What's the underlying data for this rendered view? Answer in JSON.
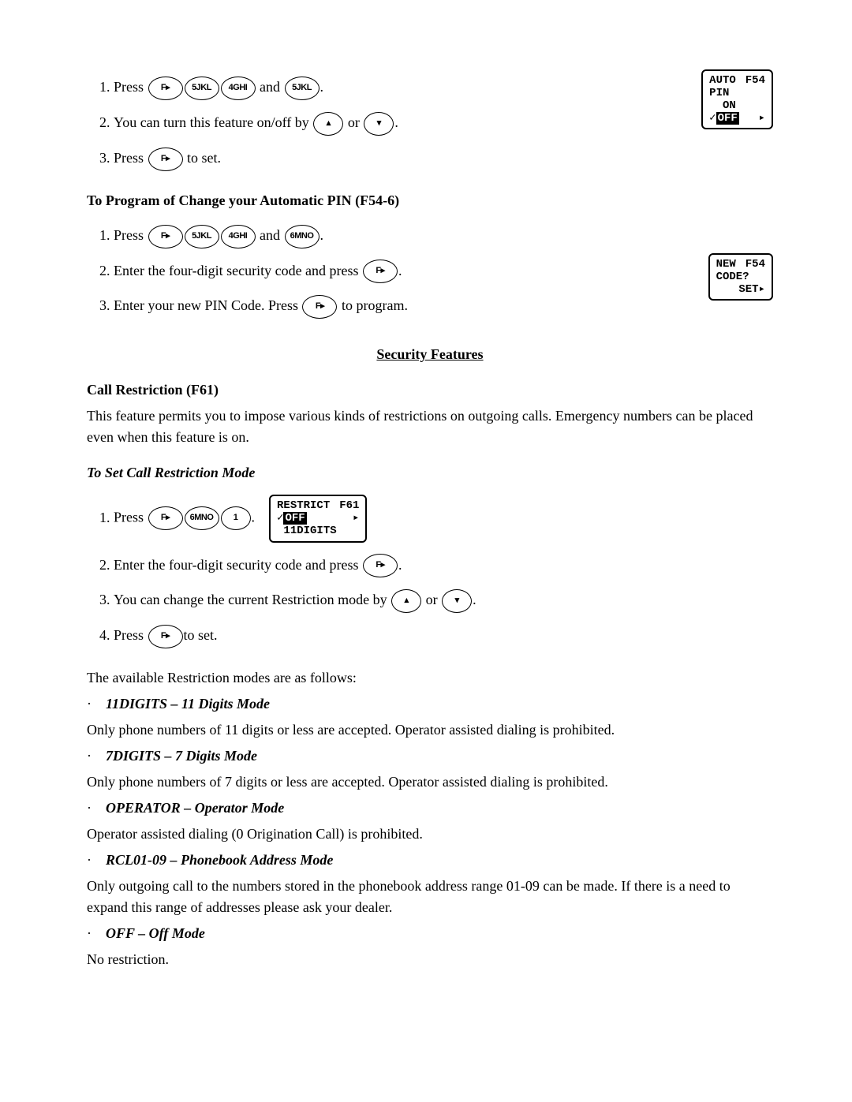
{
  "step1": {
    "press": "Press",
    "and": " and ",
    "btnF": "F▸",
    "btn5": "5JKL",
    "btn4": "4GHI",
    "btn5b": "5JKL",
    "period": ".",
    "screen": {
      "l1a": "AUTO",
      "l1b": "F54",
      "l2": "PIN",
      "l3": "  ON",
      "l4a": "✓",
      "l4sel": "OFF",
      "l4b": "▸"
    }
  },
  "step2": {
    "text1": "You can turn this feature on/off by ",
    "btnUp": "▴",
    "or": " or ",
    "btnDn": "▾",
    "period": "."
  },
  "step3": {
    "press": "Press ",
    "btnF": "F▸",
    "text2": " to set."
  },
  "h_prog": "To Program of Change your Automatic PIN (F54-6)",
  "pstep1": {
    "press": "Press",
    "btnF": "F▸",
    "btn5": "5JKL",
    "btn4": "4GHI",
    "and": " and ",
    "btn6": "6MNO",
    "period": "."
  },
  "pstep2": {
    "text": "Enter the four-digit security code and press ",
    "btnF": "F▸",
    "period": ".",
    "screen": {
      "l1a": "NEW",
      "l1b": "F54",
      "l2": "CODE?",
      "l3b": "SET▸"
    }
  },
  "pstep3": {
    "text1": "Enter your new PIN Code.  Press ",
    "btnF": "F▸",
    "text2": " to program."
  },
  "h_sec": "Security Features",
  "h_call": "Call Restriction (F61)",
  "p_call": "This feature permits you to impose various kinds of restrictions on outgoing calls.  Emergency numbers can be placed even when this feature is on.",
  "h_setcall": "To Set Call Restriction Mode",
  "cstep1": {
    "press": "Press",
    "btnF": "F▸",
    "btn6": "6MNO",
    "btn1": "1",
    "period": ".",
    "screen": {
      "l1a": "RESTRICT",
      "l1b": "F61",
      "l2a": "✓",
      "l2sel": "OFF",
      "l2b": "▸",
      "l3": " 11DIGITS"
    }
  },
  "cstep2": {
    "text": "Enter the four-digit security code and press ",
    "btnF": "F▸",
    "period": "."
  },
  "cstep3": {
    "text1": "You can change the current Restriction mode by ",
    "btnUp": "▴",
    "or": " or ",
    "btnDn": "▾",
    "period": "."
  },
  "cstep4": {
    "press": "Press ",
    "btnF": "F▸",
    "text": "to set."
  },
  "modes_intro": "The available Restriction modes are as follows:",
  "bullet": "·",
  "m1_t": "11DIGITS – 11 Digits Mode",
  "m1_d": "Only phone numbers of 11 digits or less are accepted.  Operator assisted dialing is prohibited.",
  "m2_t": "7DIGITS – 7 Digits Mode",
  "m2_d": "Only phone numbers of 7 digits or less are accepted.  Operator assisted dialing is prohibited.",
  "m3_t": "OPERATOR – Operator Mode",
  "m3_d": "Operator assisted dialing (0 Origination Call) is prohibited.",
  "m4_t": "RCL01-09 – Phonebook Address Mode",
  "m4_d": "Only outgoing call to the numbers stored in the phonebook address range 01-09 can be made.  If there is a need to expand this range of addresses please ask your dealer.",
  "m5_t": "OFF – Off Mode",
  "m5_d": "No restriction."
}
